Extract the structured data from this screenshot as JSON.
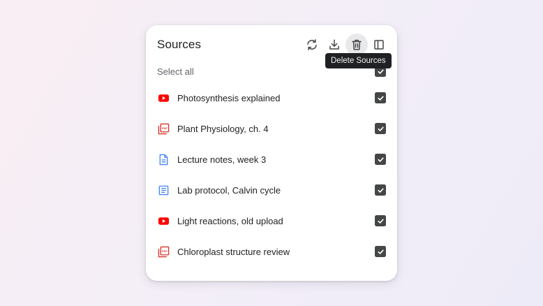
{
  "panel": {
    "title": "Sources",
    "toolbar": {
      "refresh_icon": "refresh-icon",
      "download_icon": "download-icon",
      "delete_icon": "trash-icon",
      "collapse_icon": "side-panel-icon",
      "tooltip": "Delete Sources"
    },
    "select_all_label": "Select all",
    "sources": [
      {
        "label": "Photosynthesis explained",
        "type": "youtube",
        "checked": true
      },
      {
        "label": "Plant Physiology, ch. 4",
        "type": "pdf",
        "checked": true
      },
      {
        "label": "Lecture notes, week 3",
        "type": "doc",
        "checked": true
      },
      {
        "label": "Lab protocol, Calvin cycle",
        "type": "text",
        "checked": true
      },
      {
        "label": "Light reactions, old upload",
        "type": "youtube",
        "checked": true
      },
      {
        "label": "Chloroplast structure review",
        "type": "pdf",
        "checked": true
      }
    ]
  },
  "colors": {
    "youtube": "#ff0000",
    "pdf": "#d93025",
    "doc": "#4285f4",
    "checkbox": "#444746",
    "tooltip_bg": "#202124"
  }
}
